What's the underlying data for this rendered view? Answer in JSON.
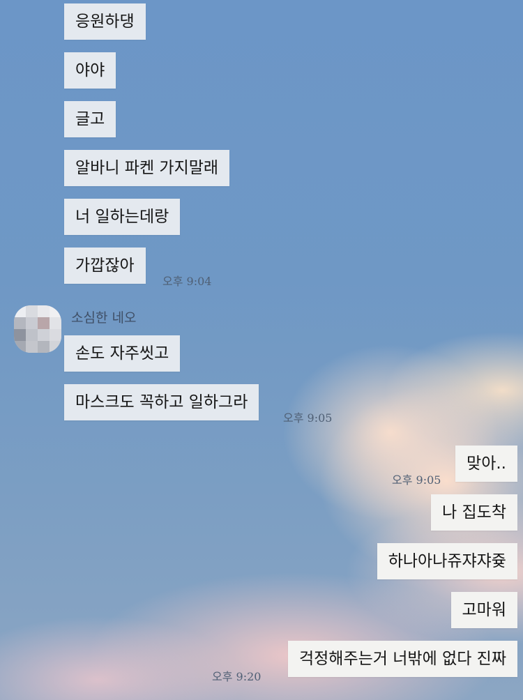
{
  "messages_received_1": [
    "응원하댕",
    "야야",
    "글고",
    "알바니 파켄 가지말래",
    "너 일하는데랑",
    "가깝잖아"
  ],
  "time_1": "오후 9:04",
  "sender_name": "소심한 네오",
  "messages_received_2": [
    "손도 자주씻고",
    "마스크도 꼭하고 일하그라"
  ],
  "time_2": "오후 9:05",
  "messages_sent": [
    "맞아..",
    "나 집도착",
    "하나아나쥬쟈쟈즂",
    "고마워",
    "걱정해주는거 너밖에 없다 진짜"
  ],
  "time_3": "오후 9:05",
  "time_4": "오후 9:20"
}
